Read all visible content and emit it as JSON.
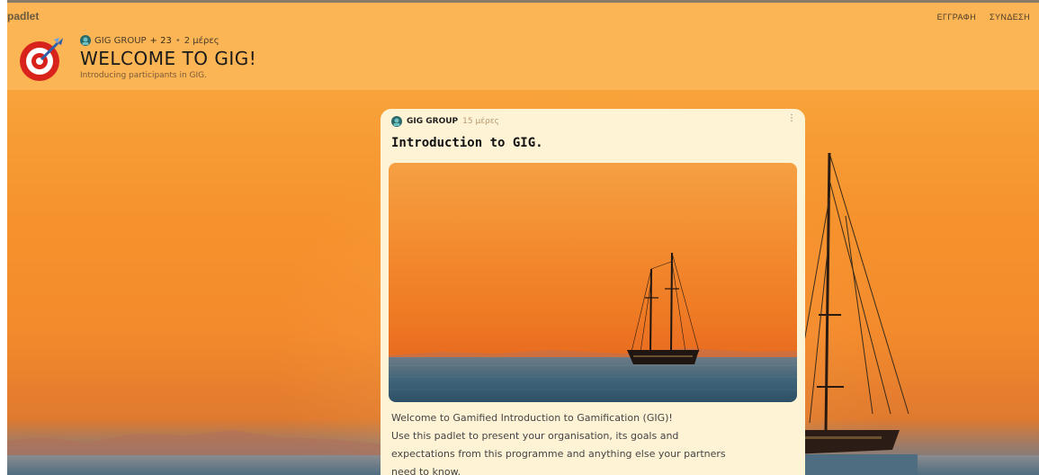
{
  "app": {
    "brand": "padlet"
  },
  "auth": {
    "register": "ΕΓΓΡΑΦΗ",
    "login": "ΣΥΝΔΕΣΗ"
  },
  "header": {
    "author": "GIG GROUP",
    "contributors": "+ 23",
    "separator": "•",
    "age": "2 μέρες",
    "title": "WELCOME TO GIG!",
    "subtitle": "Introducing participants in GIG."
  },
  "post": {
    "author": "GIG GROUP",
    "age": "15 μέρες",
    "title": "Introduction to GIG.",
    "body_lines": [
      "Welcome to Gamified Introduction to Gamification (GIG)!",
      "Use this padlet to present your organisation, its goals and",
      "expectations from this programme and anything else your partners",
      "need to know."
    ]
  },
  "icons": {
    "logo": "target-dart-icon",
    "avatar": "group-avatar-icon",
    "menu": "kebab-menu-icon"
  },
  "colors": {
    "header_bg": "#fbb554",
    "card_bg": "#fff3d6",
    "logo_red": "#d8221c"
  }
}
